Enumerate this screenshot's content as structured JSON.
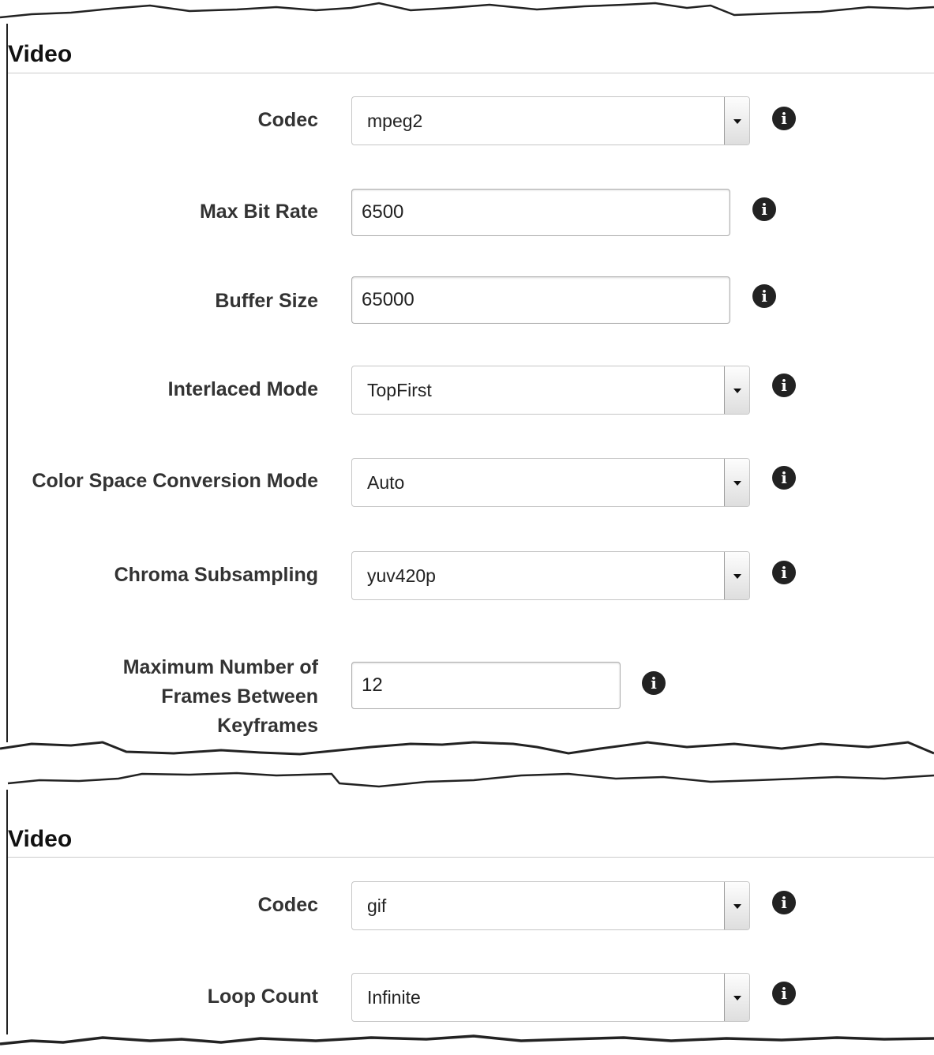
{
  "section1": {
    "title": "Video",
    "fields": [
      {
        "label": "Codec",
        "type": "select",
        "value": "mpeg2",
        "icon": "info-icon"
      },
      {
        "label": "Max Bit Rate",
        "type": "input",
        "value": "6500",
        "icon": "info-icon"
      },
      {
        "label": "Buffer Size",
        "type": "input",
        "value": "65000",
        "icon": "info-icon"
      },
      {
        "label": "Interlaced Mode",
        "type": "select",
        "value": "TopFirst",
        "icon": "info-icon"
      },
      {
        "label": "Color Space Conversion Mode",
        "type": "select",
        "value": "Auto",
        "icon": "info-icon"
      },
      {
        "label": "Chroma Subsampling",
        "type": "select",
        "value": "yuv420p",
        "icon": "info-icon"
      },
      {
        "label": "Maximum Number of Frames Between Keyframes",
        "type": "input",
        "value": "12",
        "icon": "info-icon"
      }
    ]
  },
  "section2": {
    "title": "Video",
    "fields": [
      {
        "label": "Codec",
        "type": "select",
        "value": "gif",
        "icon": "info-icon"
      },
      {
        "label": "Loop Count",
        "type": "select",
        "value": "Infinite",
        "icon": "info-icon"
      }
    ]
  },
  "info_glyph": "i",
  "colors": {
    "label": "#333333",
    "border": "#c6c6c6",
    "icon": "#222222"
  }
}
